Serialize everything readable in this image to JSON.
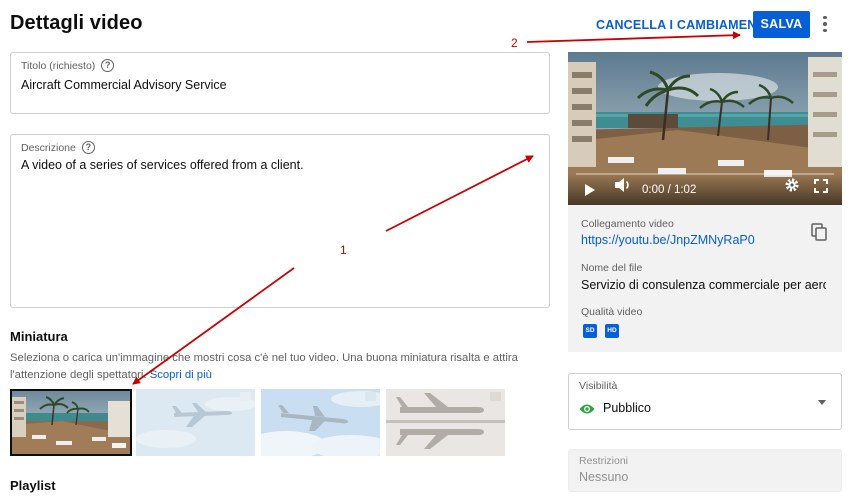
{
  "header": {
    "title": "Dettagli video",
    "cancel_label": "CANCELLA I CAMBIAMENTI",
    "save_label": "SALVA",
    "more_icon": "more-vert-icon"
  },
  "form": {
    "title_field": {
      "label": "Titolo (richiesto)",
      "value": "Aircraft Commercial Advisory Service"
    },
    "description_field": {
      "label": "Descrizione",
      "value": "A video of a series of services offered from a client."
    }
  },
  "thumbnail": {
    "heading": "Miniatura",
    "description": "Seleziona o carica un'immagine che mostri cosa c'è nel tuo video. Una buona miniatura risalta e attira l'attenzione degli spettatori.",
    "learn_more": "Scopri di più",
    "options": [
      {
        "name": "beach-resort-frame",
        "selected": true
      },
      {
        "name": "jet-frame-1",
        "selected": false
      },
      {
        "name": "jet-frame-2",
        "selected": false
      },
      {
        "name": "jet-frame-3",
        "selected": false
      }
    ]
  },
  "playlist": {
    "heading": "Playlist"
  },
  "player": {
    "time": "0:00 / 1:02",
    "progress": 0,
    "icons": [
      "play-icon",
      "volume-icon",
      "settings-gear-icon",
      "fullscreen-icon"
    ]
  },
  "video_info": {
    "link_label": "Collegamento video",
    "link_value": "https://youtu.be/JnpZMNyRaP0",
    "filename_label": "Nome del file",
    "filename_value": "Servizio di consulenza commerciale per aero…",
    "quality_label": "Qualità video",
    "quality_badges": [
      "SD",
      "HD"
    ]
  },
  "visibility": {
    "label": "Visibilità",
    "value": "Pubblico"
  },
  "restrictions": {
    "label": "Restrizioni",
    "value": "Nessuno"
  },
  "annotations": {
    "arrow_1_label": "1",
    "arrow_2_label": "2",
    "color": "#cc0000"
  },
  "colors": {
    "accent": "#065fd4",
    "text_primary": "#0d0d0d",
    "text_secondary": "#606060",
    "panel_bg": "#f2f2f2",
    "visibility_green": "#2ba640"
  }
}
